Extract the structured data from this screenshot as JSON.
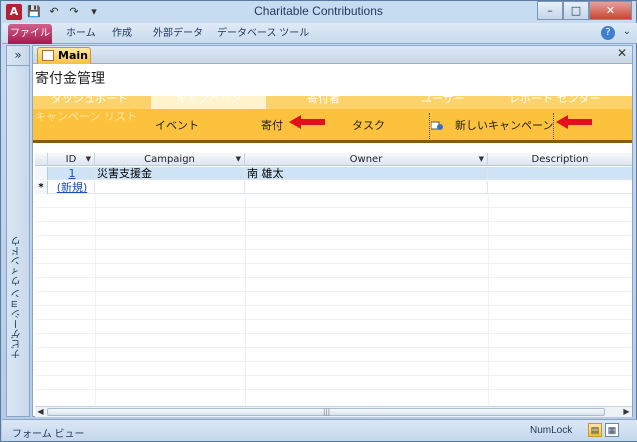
{
  "window": {
    "title": "Charitable Contributions",
    "app_icon": "A"
  },
  "quick_access": {
    "icons": [
      "save-icon",
      "undo-icon",
      "redo-icon",
      "customize-icon"
    ]
  },
  "ribbon": {
    "tabs": [
      {
        "label": "ファイル",
        "active": true
      },
      {
        "label": "ホーム"
      },
      {
        "label": "作成"
      },
      {
        "label": "外部データ"
      },
      {
        "label": "データベース ツール"
      }
    ]
  },
  "nav": {
    "toggle": "»",
    "label": "ナビゲーション ウィンドウ"
  },
  "doc_tab": {
    "label": "Main"
  },
  "form": {
    "title": "寄付金管理",
    "top_band": [
      "ダッシュボード",
      "キャンペーン",
      "寄付者",
      "ユーザー",
      "レポート センター"
    ],
    "menu": {
      "campaign_list": "キャンペーン リスト",
      "event": "イベント",
      "donation": "寄付",
      "task": "タスク",
      "new_campaign": "新しいキャンペーン"
    }
  },
  "grid": {
    "columns": [
      "ID",
      "Campaign",
      "Owner",
      "Description"
    ],
    "rows": [
      {
        "id": "1",
        "campaign": "災害支援金",
        "owner": "南 雄太"
      }
    ],
    "new_row": {
      "marker": "*",
      "label": "(新規)"
    }
  },
  "status": {
    "left": "フォーム ビュー",
    "numlock": "NumLock"
  },
  "colors": {
    "accent": "#fcc23e",
    "arrow": "#e0101c",
    "file_tab": "#b52055"
  }
}
